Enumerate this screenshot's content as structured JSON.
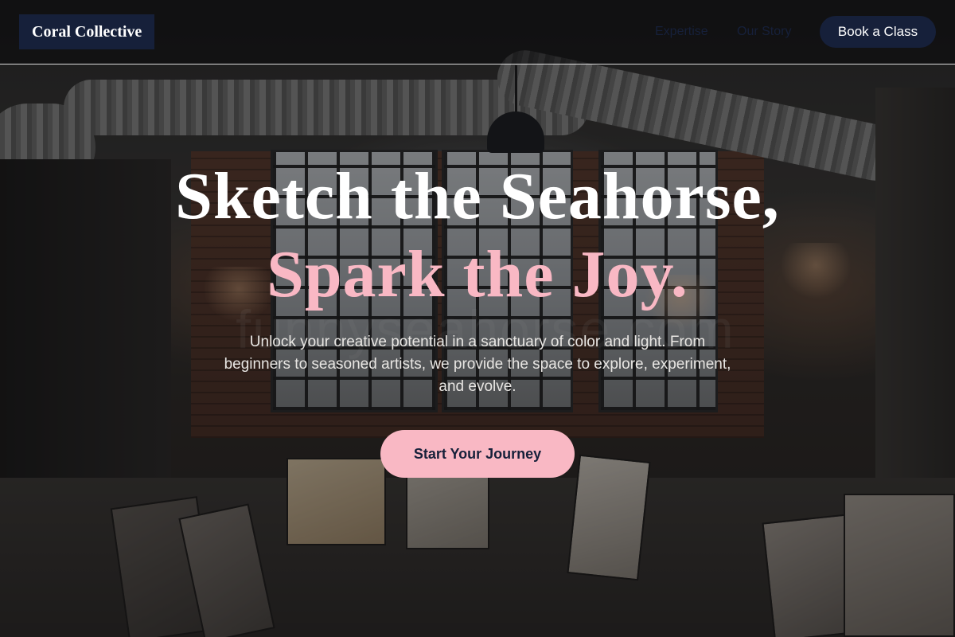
{
  "brand": {
    "name": "Coral Collective"
  },
  "nav": {
    "links": [
      "Expertise",
      "Our Story"
    ],
    "cta_label": "Book a Class"
  },
  "hero": {
    "title_line1": "Sketch the Seahorse,",
    "title_line2": "Spark the Joy.",
    "subtitle": "Unlock your creative potential in a sanctuary of color and light. From beginners to seasoned artists, we provide the space to explore, experiment, and evolve.",
    "cta_label": "Start Your Journey",
    "watermark": "funnyseahorse.com"
  },
  "colors": {
    "navy": "#16203a",
    "pink": "#f9b8c4",
    "white": "#ffffff"
  }
}
